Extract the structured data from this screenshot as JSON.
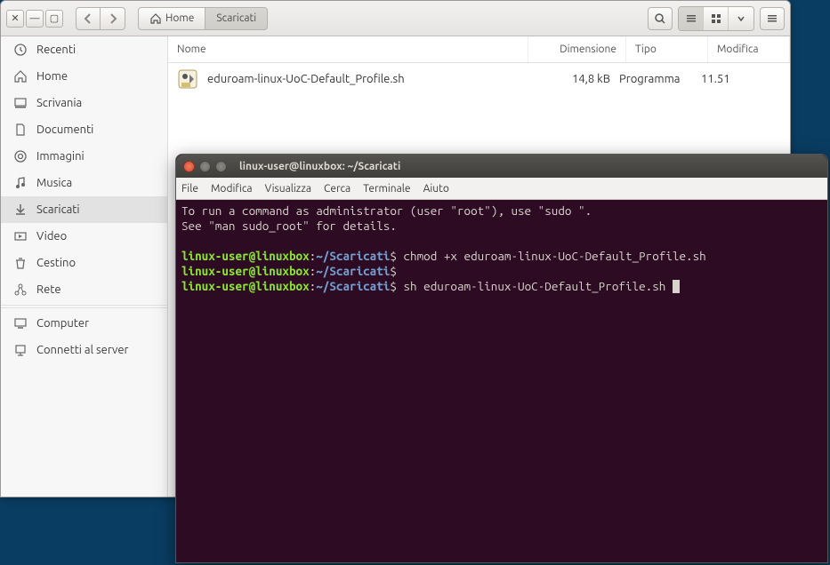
{
  "fm": {
    "breadcrumb": {
      "home": "Home",
      "current": "Scaricati"
    },
    "sidebar": [
      {
        "label": "Recenti",
        "icon": "clock"
      },
      {
        "label": "Home",
        "icon": "home"
      },
      {
        "label": "Scrivania",
        "icon": "desktop"
      },
      {
        "label": "Documenti",
        "icon": "doc"
      },
      {
        "label": "Immagini",
        "icon": "image"
      },
      {
        "label": "Musica",
        "icon": "music"
      },
      {
        "label": "Scaricati",
        "icon": "download"
      },
      {
        "label": "Video",
        "icon": "video"
      },
      {
        "label": "Cestino",
        "icon": "trash"
      },
      {
        "label": "Rete",
        "icon": "network"
      },
      {
        "label": "Computer",
        "icon": "computer"
      },
      {
        "label": "Connetti al server",
        "icon": "server"
      }
    ],
    "columns": {
      "name": "Nome",
      "size": "Dimensione",
      "type": "Tipo",
      "modified": "Modifica"
    },
    "files": [
      {
        "name": "eduroam-linux-UoC-Default_Profile.sh",
        "size": "14,8 kB",
        "type": "Programma",
        "modified": "11.51"
      }
    ]
  },
  "term": {
    "title": "linux-user@linuxbox: ~/Scaricati",
    "menu": [
      "File",
      "Modifica",
      "Visualizza",
      "Cerca",
      "Terminale",
      "Aiuto"
    ],
    "intro": [
      "To run a command as administrator (user \"root\"), use \"sudo <command>\".",
      "See \"man sudo_root\" for details."
    ],
    "prompt": {
      "userhost": "linux-user@linuxbox",
      "sep": ":",
      "path": "~/Scaricati",
      "sym": "$"
    },
    "lines": [
      {
        "cmd": " chmod +x eduroam-linux-UoC-Default_Profile.sh"
      },
      {
        "cmd": ""
      },
      {
        "cmd": " sh eduroam-linux-UoC-Default_Profile.sh ",
        "cursor": true
      }
    ]
  }
}
